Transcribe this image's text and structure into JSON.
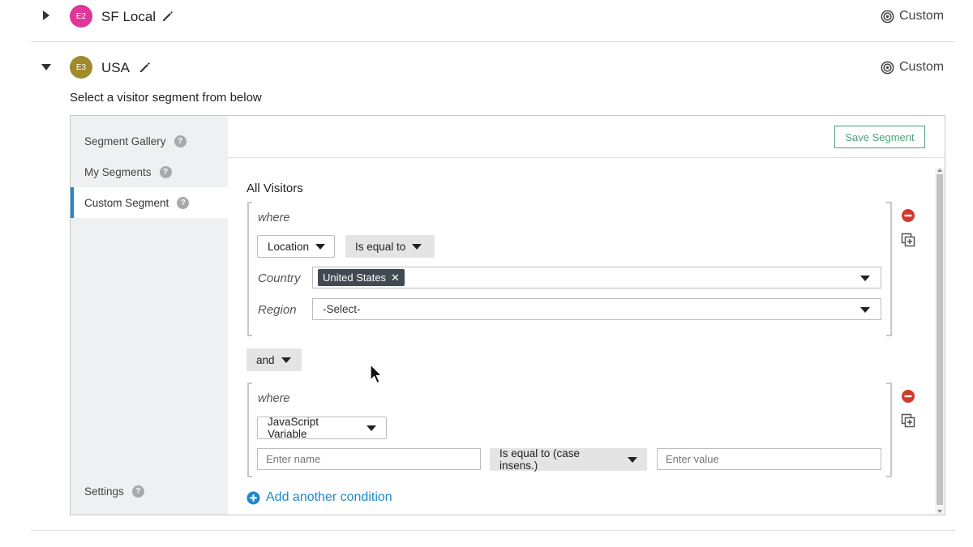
{
  "variations": [
    {
      "code": "E2",
      "name": "SF Local",
      "badge_color": "#e0369a",
      "expanded": false,
      "type_label": "Custom"
    },
    {
      "code": "E3",
      "name": "USA",
      "badge_color": "#a08a2c",
      "expanded": true,
      "type_label": "Custom"
    }
  ],
  "instruction": "Select a visitor segment from below",
  "sidebar": {
    "items": [
      {
        "label": "Segment Gallery",
        "active": false
      },
      {
        "label": "My Segments",
        "active": false
      },
      {
        "label": "Custom Segment",
        "active": true
      }
    ],
    "settings_label": "Settings",
    "help_glyph": "?"
  },
  "save_segment_label": "Save Segment",
  "all_visitors_label": "All Visitors",
  "condition1": {
    "where_label": "where",
    "attribute": "Location",
    "operator": "Is equal to",
    "country_label": "Country",
    "country_selected": "United States",
    "chip_remove_glyph": "✕",
    "region_label": "Region",
    "region_placeholder": "-Select-"
  },
  "conjunction": "and",
  "condition2": {
    "where_label": "where",
    "attribute": "JavaScript Variable",
    "name_placeholder": "Enter name",
    "operator": "Is equal to (case insens.)",
    "value_placeholder": "Enter value"
  },
  "add_condition_label": "Add another condition",
  "colors": {
    "accent": "#1e88c8",
    "save_green": "#4aa37a",
    "remove_red": "#d33a2c",
    "chip_bg": "#414a52"
  },
  "icons": {
    "expand": "caret-right-icon",
    "collapse": "caret-down-icon",
    "edit": "pencil-icon",
    "custom_type": "target-icon",
    "remove": "minus-circle-icon",
    "duplicate": "duplicate-icon",
    "add": "plus-circle-icon"
  }
}
